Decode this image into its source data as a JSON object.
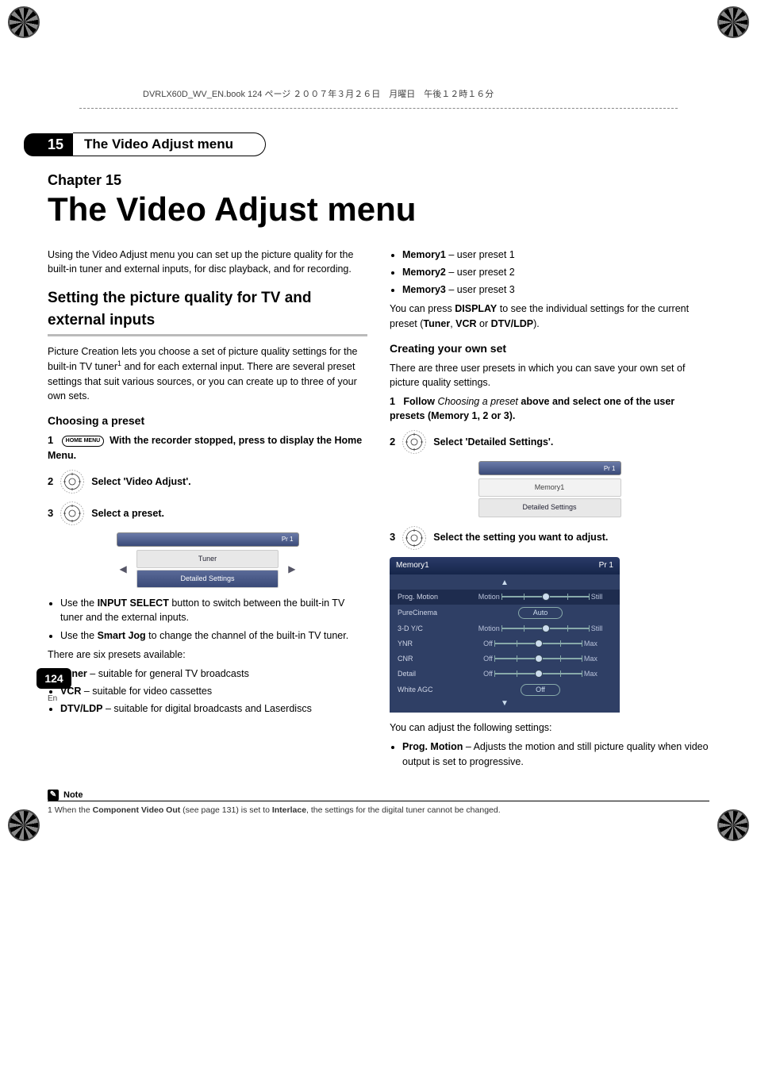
{
  "header_line": "DVRLX60D_WV_EN.book  124 ページ  ２００７年３月２６日　月曜日　午後１２時１６分",
  "section": {
    "number": "15",
    "title": "The Video Adjust menu"
  },
  "chapter_label": "Chapter 15",
  "main_title": "The Video Adjust menu",
  "left": {
    "intro": "Using the Video Adjust menu you can set up the picture quality for the built-in tuner and external inputs, for disc playback, and for recording.",
    "h2": "Setting the picture quality for TV and external inputs",
    "p1a": "Picture Creation lets you choose a set of picture quality settings for the built-in TV tuner",
    "p1b": " and for each external input. There are several preset settings that suit various sources, or you can create up to three of your own sets.",
    "h3": "Choosing a preset",
    "step1_num": "1",
    "step1_btn": "HOME MENU",
    "step1_text": "With the recorder stopped, press to display the Home Menu.",
    "step2_num": "2",
    "step2_text": "Select 'Video Adjust'.",
    "step3_num": "3",
    "step3_text": "Select a preset.",
    "ui1_badge": "Pr 1",
    "ui1_item1": "Tuner",
    "ui1_item2": "Detailed Settings",
    "bullet1a": "Use the ",
    "bullet1b_bold": "INPUT SELECT",
    "bullet1c": " button to switch between the built-in TV tuner and the external inputs.",
    "bullet2a": "Use the ",
    "bullet2b_bold": "Smart Jog",
    "bullet2c": " to change the channel of the built-in TV tuner.",
    "six_presets": "There are six presets available:",
    "preset_tuner_b": "Tuner",
    "preset_tuner_t": " – suitable for general TV broadcasts",
    "preset_vcr_b": "VCR",
    "preset_vcr_t": " – suitable for video cassettes",
    "preset_dtv_b": "DTV/LDP",
    "preset_dtv_t": " – suitable for digital broadcasts and Laserdiscs"
  },
  "right": {
    "preset_m1_b": "Memory1",
    "preset_m1_t": " – user preset 1",
    "preset_m2_b": "Memory2",
    "preset_m2_t": " – user preset 2",
    "preset_m3_b": "Memory3",
    "preset_m3_t": " – user preset 3",
    "display_a": "You can press ",
    "display_b": "DISPLAY",
    "display_c": " to see the individual settings for the current preset (",
    "display_d": "Tuner",
    "display_e": ", ",
    "display_f": "VCR",
    "display_g": " or ",
    "display_h": "DTV/LDP",
    "display_i": ").",
    "h3": "Creating your own set",
    "p_create": "There are three user presets in which you can save your own set of picture quality settings.",
    "cstep1_num": "1",
    "cstep1_a": "Follow ",
    "cstep1_b": "Choosing a preset",
    "cstep1_c": " above and select one of the user presets (Memory 1, 2 or 3).",
    "cstep2_num": "2",
    "cstep2_text": "Select 'Detailed Settings'.",
    "ui2_badge": "Pr 1",
    "ui2_item1": "Memory1",
    "ui2_item2": "Detailed Settings",
    "cstep3_num": "3",
    "cstep3_text": "Select the setting you want to adjust.",
    "panel": {
      "title_left": "Memory1",
      "title_right": "Pr 1",
      "rows": [
        {
          "label": "Prog. Motion",
          "left": "Motion",
          "right": "Still",
          "type": "slider",
          "pos": 0.5
        },
        {
          "label": "PureCinema",
          "val": "Auto",
          "type": "pill"
        },
        {
          "label": "3-D Y/C",
          "left": "Motion",
          "right": "Still",
          "type": "slider",
          "pos": 0.5
        },
        {
          "label": "YNR",
          "left": "Off",
          "right": "Max",
          "type": "slider",
          "pos": 0.5
        },
        {
          "label": "CNR",
          "left": "Off",
          "right": "Max",
          "type": "slider",
          "pos": 0.5
        },
        {
          "label": "Detail",
          "left": "Off",
          "right": "Max",
          "type": "slider",
          "pos": 0.5
        },
        {
          "label": "White AGC",
          "val": "Off",
          "type": "pill"
        }
      ]
    },
    "adjust_intro": "You can adjust the following settings:",
    "adj_b": "Prog. Motion",
    "adj_t": " – Adjusts the motion and still picture quality when video output is set to progressive."
  },
  "note_label": "Note",
  "footnote_a": "1 When the ",
  "footnote_b": "Component Video Out",
  "footnote_c": " (see page 131) is set to ",
  "footnote_d": "Interlace",
  "footnote_e": ", the settings for the digital tuner cannot be changed.",
  "page_number": "124",
  "page_lang": "En"
}
